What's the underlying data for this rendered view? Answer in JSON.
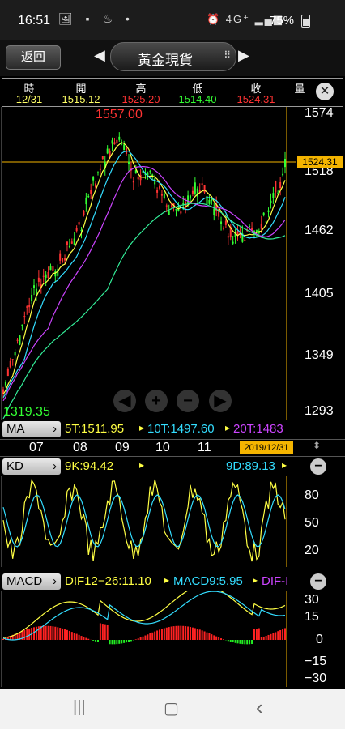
{
  "status": {
    "time": "16:51",
    "left_icons": "🖼 ▪ ♨ •",
    "right_icons": "⏰ 4G⁺ ▂▄▆",
    "battery": "75%"
  },
  "topbar": {
    "back": "返回",
    "title": "黃金現貨",
    "grip": "⠿"
  },
  "quote": {
    "headers": [
      "時",
      "開",
      "高",
      "低",
      "收",
      "量"
    ],
    "values": [
      "12/31",
      "1515.12",
      "1525.20",
      "1514.40",
      "1524.31",
      "--"
    ],
    "colors": [
      "#ffff66",
      "#ffff66",
      "#ff3333",
      "#33ff33",
      "#ff3333",
      "#ffff66"
    ]
  },
  "main_chart": {
    "high_label": "1557.00",
    "low_label": "1319.35",
    "y_axis": [
      "1574",
      "1518",
      "1462",
      "1405",
      "1349",
      "1293"
    ],
    "current_price": "1524.31",
    "x_axis": [
      "07",
      "08",
      "09",
      "10",
      "11"
    ],
    "date_tag": "2019/12/31"
  },
  "ma_bar": {
    "label": "MA",
    "items": [
      {
        "text": "5T:1511.95",
        "color": "#ffff44"
      },
      {
        "text": "10T:1497.60",
        "color": "#33ddff"
      },
      {
        "text": "20T:1483",
        "color": "#cc44ff"
      }
    ]
  },
  "kd_bar": {
    "label": "KD",
    "k": "9K:94.42",
    "d": "9D:89.13"
  },
  "kd_axis": [
    "80",
    "50",
    "20"
  ],
  "macd_bar": {
    "label": "MACD",
    "dif": "DIF12−26:11.10",
    "macd": "MACD9:5.95",
    "osc": "DIF-I"
  },
  "macd_axis": [
    "30",
    "15",
    "0",
    "−15",
    "−30"
  ],
  "nav": {
    "recent": "|||",
    "home": "▢",
    "back": "‹"
  }
}
